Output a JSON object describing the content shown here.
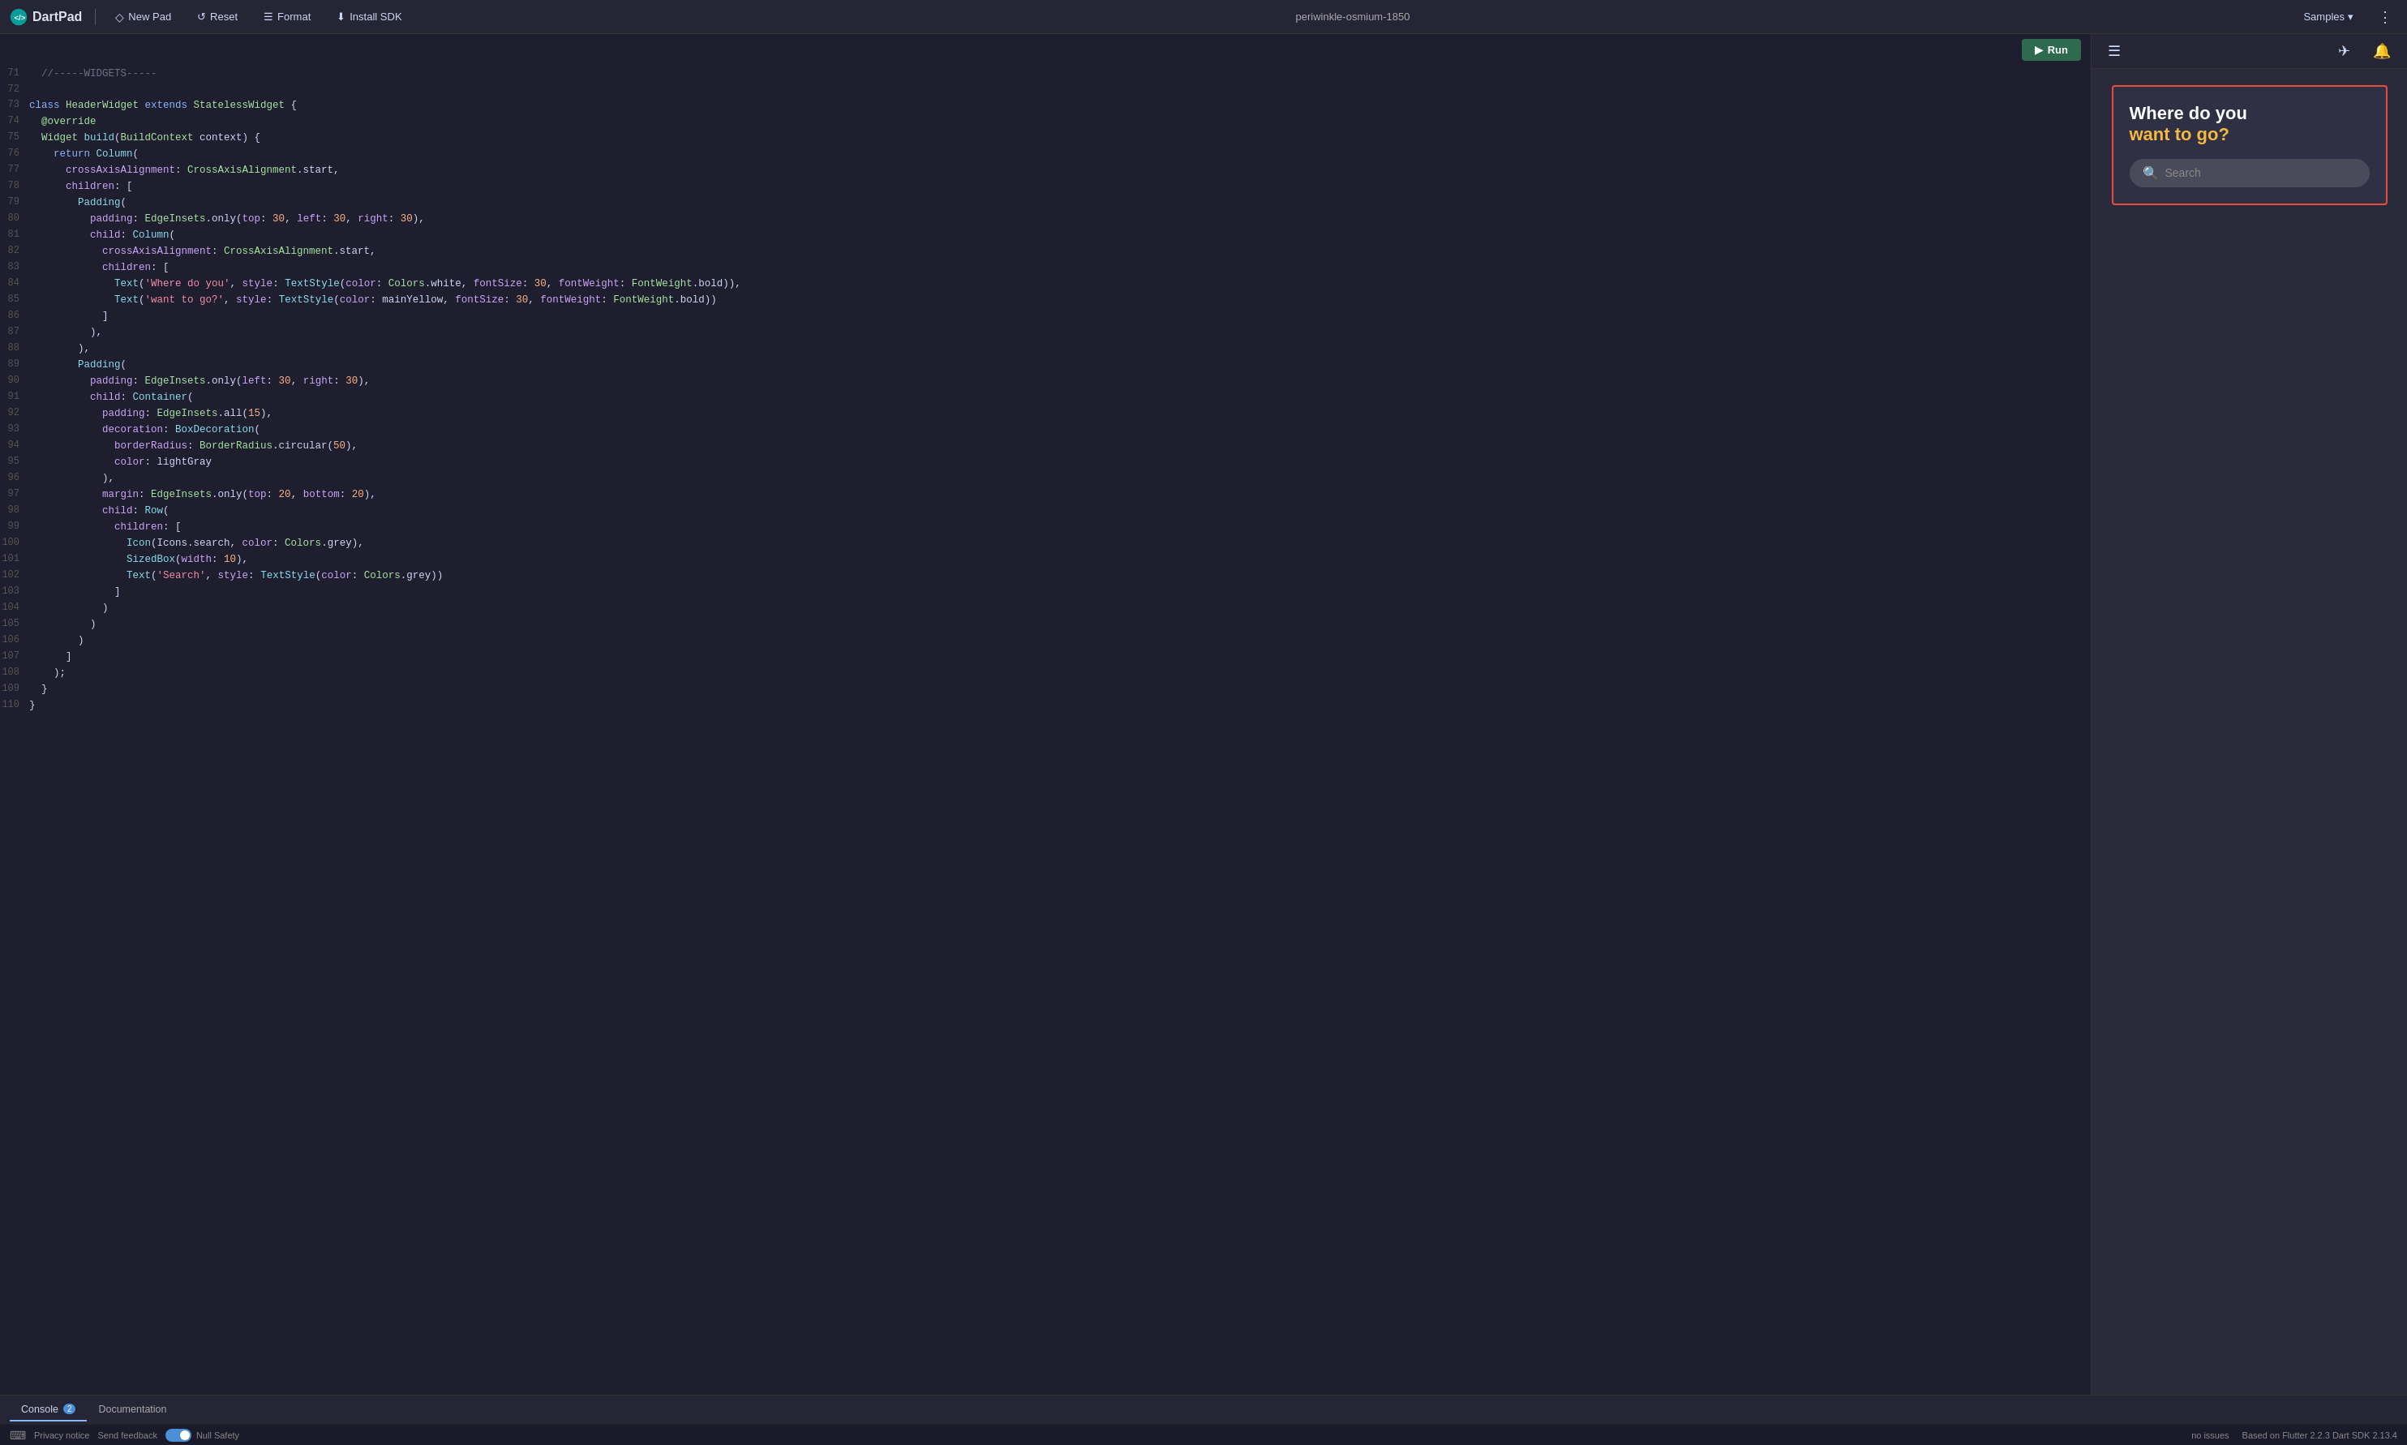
{
  "navbar": {
    "brand": "DartPad",
    "new_pad_label": "New Pad",
    "reset_label": "Reset",
    "format_label": "Format",
    "install_sdk_label": "Install SDK",
    "title": "periwinkle-osmium-1850",
    "samples_label": "Samples"
  },
  "toolbar": {
    "run_label": "Run"
  },
  "code": {
    "lines": [
      {
        "num": "71",
        "tokens": [
          {
            "t": "comment",
            "v": "  //-----WIDGETS-----"
          }
        ]
      },
      {
        "num": "72",
        "tokens": []
      },
      {
        "num": "73",
        "tokens": [
          {
            "t": "kw",
            "v": "class "
          },
          {
            "t": "cls",
            "v": "HeaderWidget "
          },
          {
            "t": "kw",
            "v": "extends "
          },
          {
            "t": "cls",
            "v": "StatelessWidget "
          },
          {
            "t": "plain",
            "v": "{"
          }
        ]
      },
      {
        "num": "74",
        "tokens": [
          {
            "t": "ann",
            "v": "  @override"
          }
        ]
      },
      {
        "num": "75",
        "tokens": [
          {
            "t": "plain",
            "v": "  "
          },
          {
            "t": "cls",
            "v": "Widget "
          },
          {
            "t": "fn",
            "v": "build"
          },
          {
            "t": "plain",
            "v": "("
          },
          {
            "t": "cls",
            "v": "BuildContext "
          },
          {
            "t": "plain",
            "v": "context) {"
          }
        ]
      },
      {
        "num": "76",
        "tokens": [
          {
            "t": "kw",
            "v": "    return "
          },
          {
            "t": "fn",
            "v": "Column"
          },
          {
            "t": "plain",
            "v": "("
          }
        ]
      },
      {
        "num": "77",
        "tokens": [
          {
            "t": "prop",
            "v": "      crossAxisAlignment"
          },
          {
            "t": "plain",
            "v": ": "
          },
          {
            "t": "cls",
            "v": "CrossAxisAlignment"
          },
          {
            "t": "plain",
            "v": ".start,"
          }
        ]
      },
      {
        "num": "78",
        "tokens": [
          {
            "t": "prop",
            "v": "      children"
          },
          {
            "t": "plain",
            "v": ": ["
          }
        ]
      },
      {
        "num": "79",
        "tokens": [
          {
            "t": "plain",
            "v": "        "
          },
          {
            "t": "fn",
            "v": "Padding"
          },
          {
            "t": "plain",
            "v": "("
          }
        ]
      },
      {
        "num": "80",
        "tokens": [
          {
            "t": "prop",
            "v": "          padding"
          },
          {
            "t": "plain",
            "v": ": "
          },
          {
            "t": "cls",
            "v": "EdgeInsets"
          },
          {
            "t": "plain",
            "v": ".only("
          },
          {
            "t": "prop",
            "v": "top"
          },
          {
            "t": "plain",
            "v": ": "
          },
          {
            "t": "num",
            "v": "30"
          },
          {
            "t": "plain",
            "v": ", "
          },
          {
            "t": "prop",
            "v": "left"
          },
          {
            "t": "plain",
            "v": ": "
          },
          {
            "t": "num",
            "v": "30"
          },
          {
            "t": "plain",
            "v": ", "
          },
          {
            "t": "prop",
            "v": "right"
          },
          {
            "t": "plain",
            "v": ": "
          },
          {
            "t": "num",
            "v": "30"
          },
          {
            "t": "plain",
            "v": "),"
          }
        ]
      },
      {
        "num": "81",
        "tokens": [
          {
            "t": "prop",
            "v": "          child"
          },
          {
            "t": "plain",
            "v": ": "
          },
          {
            "t": "fn",
            "v": "Column"
          },
          {
            "t": "plain",
            "v": "("
          }
        ]
      },
      {
        "num": "82",
        "tokens": [
          {
            "t": "prop",
            "v": "            crossAxisAlignment"
          },
          {
            "t": "plain",
            "v": ": "
          },
          {
            "t": "cls",
            "v": "CrossAxisAlignment"
          },
          {
            "t": "plain",
            "v": ".start,"
          }
        ]
      },
      {
        "num": "83",
        "tokens": [
          {
            "t": "prop",
            "v": "            children"
          },
          {
            "t": "plain",
            "v": ": ["
          }
        ]
      },
      {
        "num": "84",
        "tokens": [
          {
            "t": "plain",
            "v": "              "
          },
          {
            "t": "fn",
            "v": "Text"
          },
          {
            "t": "plain",
            "v": "("
          },
          {
            "t": "str",
            "v": "'Where do you'"
          },
          {
            "t": "plain",
            "v": ", "
          },
          {
            "t": "prop",
            "v": "style"
          },
          {
            "t": "plain",
            "v": ": "
          },
          {
            "t": "fn",
            "v": "TextStyle"
          },
          {
            "t": "plain",
            "v": "("
          },
          {
            "t": "prop",
            "v": "color"
          },
          {
            "t": "plain",
            "v": ": "
          },
          {
            "t": "cls",
            "v": "Colors"
          },
          {
            "t": "plain",
            "v": ".white, "
          },
          {
            "t": "prop",
            "v": "fontSize"
          },
          {
            "t": "plain",
            "v": ": "
          },
          {
            "t": "num",
            "v": "30"
          },
          {
            "t": "plain",
            "v": ", "
          },
          {
            "t": "prop",
            "v": "fontWeight"
          },
          {
            "t": "plain",
            "v": ": "
          },
          {
            "t": "cls",
            "v": "FontWeight"
          },
          {
            "t": "plain",
            "v": ".bold)),"
          }
        ]
      },
      {
        "num": "85",
        "tokens": [
          {
            "t": "plain",
            "v": "              "
          },
          {
            "t": "fn",
            "v": "Text"
          },
          {
            "t": "plain",
            "v": "("
          },
          {
            "t": "str",
            "v": "'want to go?'"
          },
          {
            "t": "plain",
            "v": ", "
          },
          {
            "t": "prop",
            "v": "style"
          },
          {
            "t": "plain",
            "v": ": "
          },
          {
            "t": "fn",
            "v": "TextStyle"
          },
          {
            "t": "plain",
            "v": "("
          },
          {
            "t": "prop",
            "v": "color"
          },
          {
            "t": "plain",
            "v": ": mainYellow, "
          },
          {
            "t": "prop",
            "v": "fontSize"
          },
          {
            "t": "plain",
            "v": ": "
          },
          {
            "t": "num",
            "v": "30"
          },
          {
            "t": "plain",
            "v": ", "
          },
          {
            "t": "prop",
            "v": "fontWeight"
          },
          {
            "t": "plain",
            "v": ": "
          },
          {
            "t": "cls",
            "v": "FontWeight"
          },
          {
            "t": "plain",
            "v": ".bold))"
          }
        ]
      },
      {
        "num": "86",
        "tokens": [
          {
            "t": "plain",
            "v": "            ]"
          }
        ]
      },
      {
        "num": "87",
        "tokens": [
          {
            "t": "plain",
            "v": "          ),"
          }
        ]
      },
      {
        "num": "88",
        "tokens": [
          {
            "t": "plain",
            "v": "        ),"
          }
        ]
      },
      {
        "num": "89",
        "tokens": [
          {
            "t": "plain",
            "v": "        "
          },
          {
            "t": "fn",
            "v": "Padding"
          },
          {
            "t": "plain",
            "v": "("
          }
        ]
      },
      {
        "num": "90",
        "tokens": [
          {
            "t": "prop",
            "v": "          padding"
          },
          {
            "t": "plain",
            "v": ": "
          },
          {
            "t": "cls",
            "v": "EdgeInsets"
          },
          {
            "t": "plain",
            "v": ".only("
          },
          {
            "t": "prop",
            "v": "left"
          },
          {
            "t": "plain",
            "v": ": "
          },
          {
            "t": "num",
            "v": "30"
          },
          {
            "t": "plain",
            "v": ", "
          },
          {
            "t": "prop",
            "v": "right"
          },
          {
            "t": "plain",
            "v": ": "
          },
          {
            "t": "num",
            "v": "30"
          },
          {
            "t": "plain",
            "v": "),"
          }
        ]
      },
      {
        "num": "91",
        "tokens": [
          {
            "t": "prop",
            "v": "          child"
          },
          {
            "t": "plain",
            "v": ": "
          },
          {
            "t": "fn",
            "v": "Container"
          },
          {
            "t": "plain",
            "v": "("
          }
        ]
      },
      {
        "num": "92",
        "tokens": [
          {
            "t": "prop",
            "v": "            padding"
          },
          {
            "t": "plain",
            "v": ": "
          },
          {
            "t": "cls",
            "v": "EdgeInsets"
          },
          {
            "t": "plain",
            "v": ".all("
          },
          {
            "t": "num",
            "v": "15"
          },
          {
            "t": "plain",
            "v": "),"
          }
        ]
      },
      {
        "num": "93",
        "tokens": [
          {
            "t": "prop",
            "v": "            decoration"
          },
          {
            "t": "plain",
            "v": ": "
          },
          {
            "t": "fn",
            "v": "BoxDecoration"
          },
          {
            "t": "plain",
            "v": "("
          }
        ]
      },
      {
        "num": "94",
        "tokens": [
          {
            "t": "prop",
            "v": "              borderRadius"
          },
          {
            "t": "plain",
            "v": ": "
          },
          {
            "t": "cls",
            "v": "BorderRadius"
          },
          {
            "t": "plain",
            "v": ".circular("
          },
          {
            "t": "num",
            "v": "50"
          },
          {
            "t": "plain",
            "v": "),"
          }
        ]
      },
      {
        "num": "95",
        "tokens": [
          {
            "t": "prop",
            "v": "              color"
          },
          {
            "t": "plain",
            "v": ": lightGray"
          }
        ]
      },
      {
        "num": "96",
        "tokens": [
          {
            "t": "plain",
            "v": "            ),"
          }
        ]
      },
      {
        "num": "97",
        "tokens": [
          {
            "t": "prop",
            "v": "            margin"
          },
          {
            "t": "plain",
            "v": ": "
          },
          {
            "t": "cls",
            "v": "EdgeInsets"
          },
          {
            "t": "plain",
            "v": ".only("
          },
          {
            "t": "prop",
            "v": "top"
          },
          {
            "t": "plain",
            "v": ": "
          },
          {
            "t": "num",
            "v": "20"
          },
          {
            "t": "plain",
            "v": ", "
          },
          {
            "t": "prop",
            "v": "bottom"
          },
          {
            "t": "plain",
            "v": ": "
          },
          {
            "t": "num",
            "v": "20"
          },
          {
            "t": "plain",
            "v": "),"
          }
        ]
      },
      {
        "num": "98",
        "tokens": [
          {
            "t": "prop",
            "v": "            child"
          },
          {
            "t": "plain",
            "v": ": "
          },
          {
            "t": "fn",
            "v": "Row"
          },
          {
            "t": "plain",
            "v": "("
          }
        ]
      },
      {
        "num": "99",
        "tokens": [
          {
            "t": "prop",
            "v": "              children"
          },
          {
            "t": "plain",
            "v": ": ["
          }
        ]
      },
      {
        "num": "100",
        "tokens": [
          {
            "t": "plain",
            "v": "                "
          },
          {
            "t": "fn",
            "v": "Icon"
          },
          {
            "t": "plain",
            "v": "(Icons.search, "
          },
          {
            "t": "prop",
            "v": "color"
          },
          {
            "t": "plain",
            "v": ": "
          },
          {
            "t": "cls",
            "v": "Colors"
          },
          {
            "t": "plain",
            "v": ".grey),"
          }
        ]
      },
      {
        "num": "101",
        "tokens": [
          {
            "t": "plain",
            "v": "                "
          },
          {
            "t": "fn",
            "v": "SizedBox"
          },
          {
            "t": "plain",
            "v": "("
          },
          {
            "t": "prop",
            "v": "width"
          },
          {
            "t": "plain",
            "v": ": "
          },
          {
            "t": "num",
            "v": "10"
          },
          {
            "t": "plain",
            "v": "),"
          }
        ]
      },
      {
        "num": "102",
        "tokens": [
          {
            "t": "plain",
            "v": "                "
          },
          {
            "t": "fn",
            "v": "Text"
          },
          {
            "t": "plain",
            "v": "("
          },
          {
            "t": "str",
            "v": "'Search'"
          },
          {
            "t": "plain",
            "v": ", "
          },
          {
            "t": "prop",
            "v": "style"
          },
          {
            "t": "plain",
            "v": ": "
          },
          {
            "t": "fn",
            "v": "TextStyle"
          },
          {
            "t": "plain",
            "v": "("
          },
          {
            "t": "prop",
            "v": "color"
          },
          {
            "t": "plain",
            "v": ": "
          },
          {
            "t": "cls",
            "v": "Colors"
          },
          {
            "t": "plain",
            "v": ".grey))"
          }
        ]
      },
      {
        "num": "103",
        "tokens": [
          {
            "t": "plain",
            "v": "              ]"
          }
        ]
      },
      {
        "num": "104",
        "tokens": [
          {
            "t": "plain",
            "v": "            )"
          }
        ]
      },
      {
        "num": "105",
        "tokens": [
          {
            "t": "plain",
            "v": "          )"
          }
        ]
      },
      {
        "num": "106",
        "tokens": [
          {
            "t": "plain",
            "v": "        )"
          }
        ]
      },
      {
        "num": "107",
        "tokens": [
          {
            "t": "plain",
            "v": "      ]"
          }
        ]
      },
      {
        "num": "108",
        "tokens": [
          {
            "t": "plain",
            "v": "    );"
          }
        ]
      },
      {
        "num": "109",
        "tokens": [
          {
            "t": "plain",
            "v": "  }"
          }
        ]
      },
      {
        "num": "110",
        "tokens": [
          {
            "t": "plain",
            "v": "}"
          }
        ]
      }
    ]
  },
  "preview": {
    "widget_title_line1": "Where do you",
    "widget_title_line2": "want to go?",
    "search_placeholder": "Search"
  },
  "bottom": {
    "tab_console_label": "Console",
    "tab_console_badge": "2",
    "tab_docs_label": "Documentation"
  },
  "statusbar": {
    "no_issues": "no issues",
    "flutter_info": "Based on Flutter 2.2.3 Dart SDK 2.13.4",
    "privacy_notice": "Privacy notice",
    "send_feedback": "Send feedback",
    "null_safety_label": "Null Safety"
  }
}
